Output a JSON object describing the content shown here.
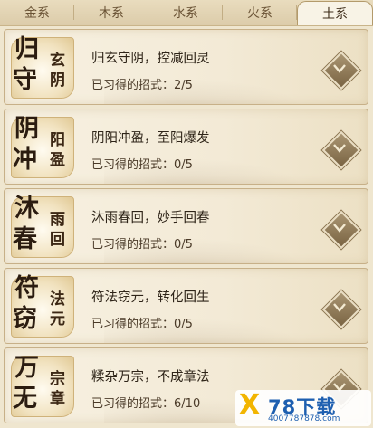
{
  "tabs": [
    {
      "label": "金系",
      "active": false
    },
    {
      "label": "木系",
      "active": false
    },
    {
      "label": "水系",
      "active": false
    },
    {
      "label": "火系",
      "active": false
    },
    {
      "label": "土系",
      "active": true
    }
  ],
  "progress_label": "已习得的招式：",
  "cards": [
    {
      "emblem": {
        "big1": "归",
        "big2": "守",
        "sm1": "玄",
        "sm2": "阴"
      },
      "name": "归玄守阴，控减回灵",
      "learned": 2,
      "total": 5,
      "progress_text": "2/5"
    },
    {
      "emblem": {
        "big1": "阴",
        "big2": "冲",
        "sm1": "阳",
        "sm2": "盈"
      },
      "name": "阴阳冲盈，至阳爆发",
      "learned": 0,
      "total": 5,
      "progress_text": "0/5"
    },
    {
      "emblem": {
        "big1": "沐",
        "big2": "春",
        "sm1": "雨",
        "sm2": "回"
      },
      "name": "沐雨春回，妙手回春",
      "learned": 0,
      "total": 5,
      "progress_text": "0/5"
    },
    {
      "emblem": {
        "big1": "符",
        "big2": "窃",
        "sm1": "法",
        "sm2": "元"
      },
      "name": "符法窃元，转化回生",
      "learned": 0,
      "total": 5,
      "progress_text": "0/5"
    },
    {
      "emblem": {
        "big1": "万",
        "big2": "无",
        "sm1": "宗",
        "sm2": "章"
      },
      "name": "糅杂万宗，不成章法",
      "learned": 6,
      "total": 10,
      "progress_text": "6/10"
    }
  ],
  "watermark": {
    "logo": "X",
    "title": "78下载",
    "url": "4007787878.com"
  },
  "colors": {
    "accent_brown": "#7a6443",
    "text": "#2e2418",
    "watermark_blue": "#1e5fb0"
  }
}
